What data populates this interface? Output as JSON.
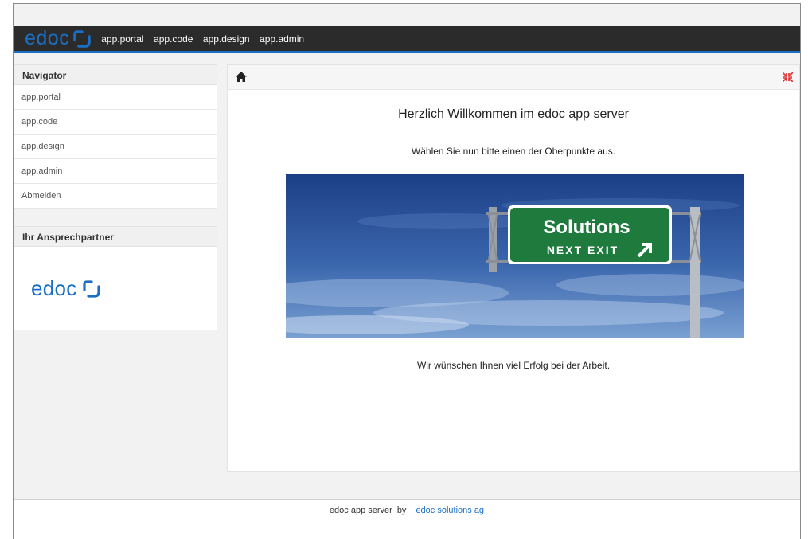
{
  "brand": {
    "logo_text": "edoc",
    "color": "#1a6fc4"
  },
  "topnav": [
    "app.portal",
    "app.code",
    "app.design",
    "app.admin"
  ],
  "sidebar": {
    "navigator_title": "Navigator",
    "items": [
      "app.portal",
      "app.code",
      "app.design",
      "app.admin",
      "Abmelden"
    ],
    "contact_title": "Ihr Ansprechpartner",
    "contact_logo_text": "edoc"
  },
  "main": {
    "title": "Herzlich Willkommen im edoc app server",
    "subtitle": "Wählen Sie nun bitte einen der Oberpunkte aus.",
    "closing": "Wir wünschen Ihnen viel Erfolg bei der Arbeit.",
    "banner": {
      "sign_title": "Solutions",
      "sign_sub": "NEXT EXIT"
    }
  },
  "footer": {
    "product": "edoc app server",
    "by": "by",
    "company": "edoc solutions ag"
  }
}
